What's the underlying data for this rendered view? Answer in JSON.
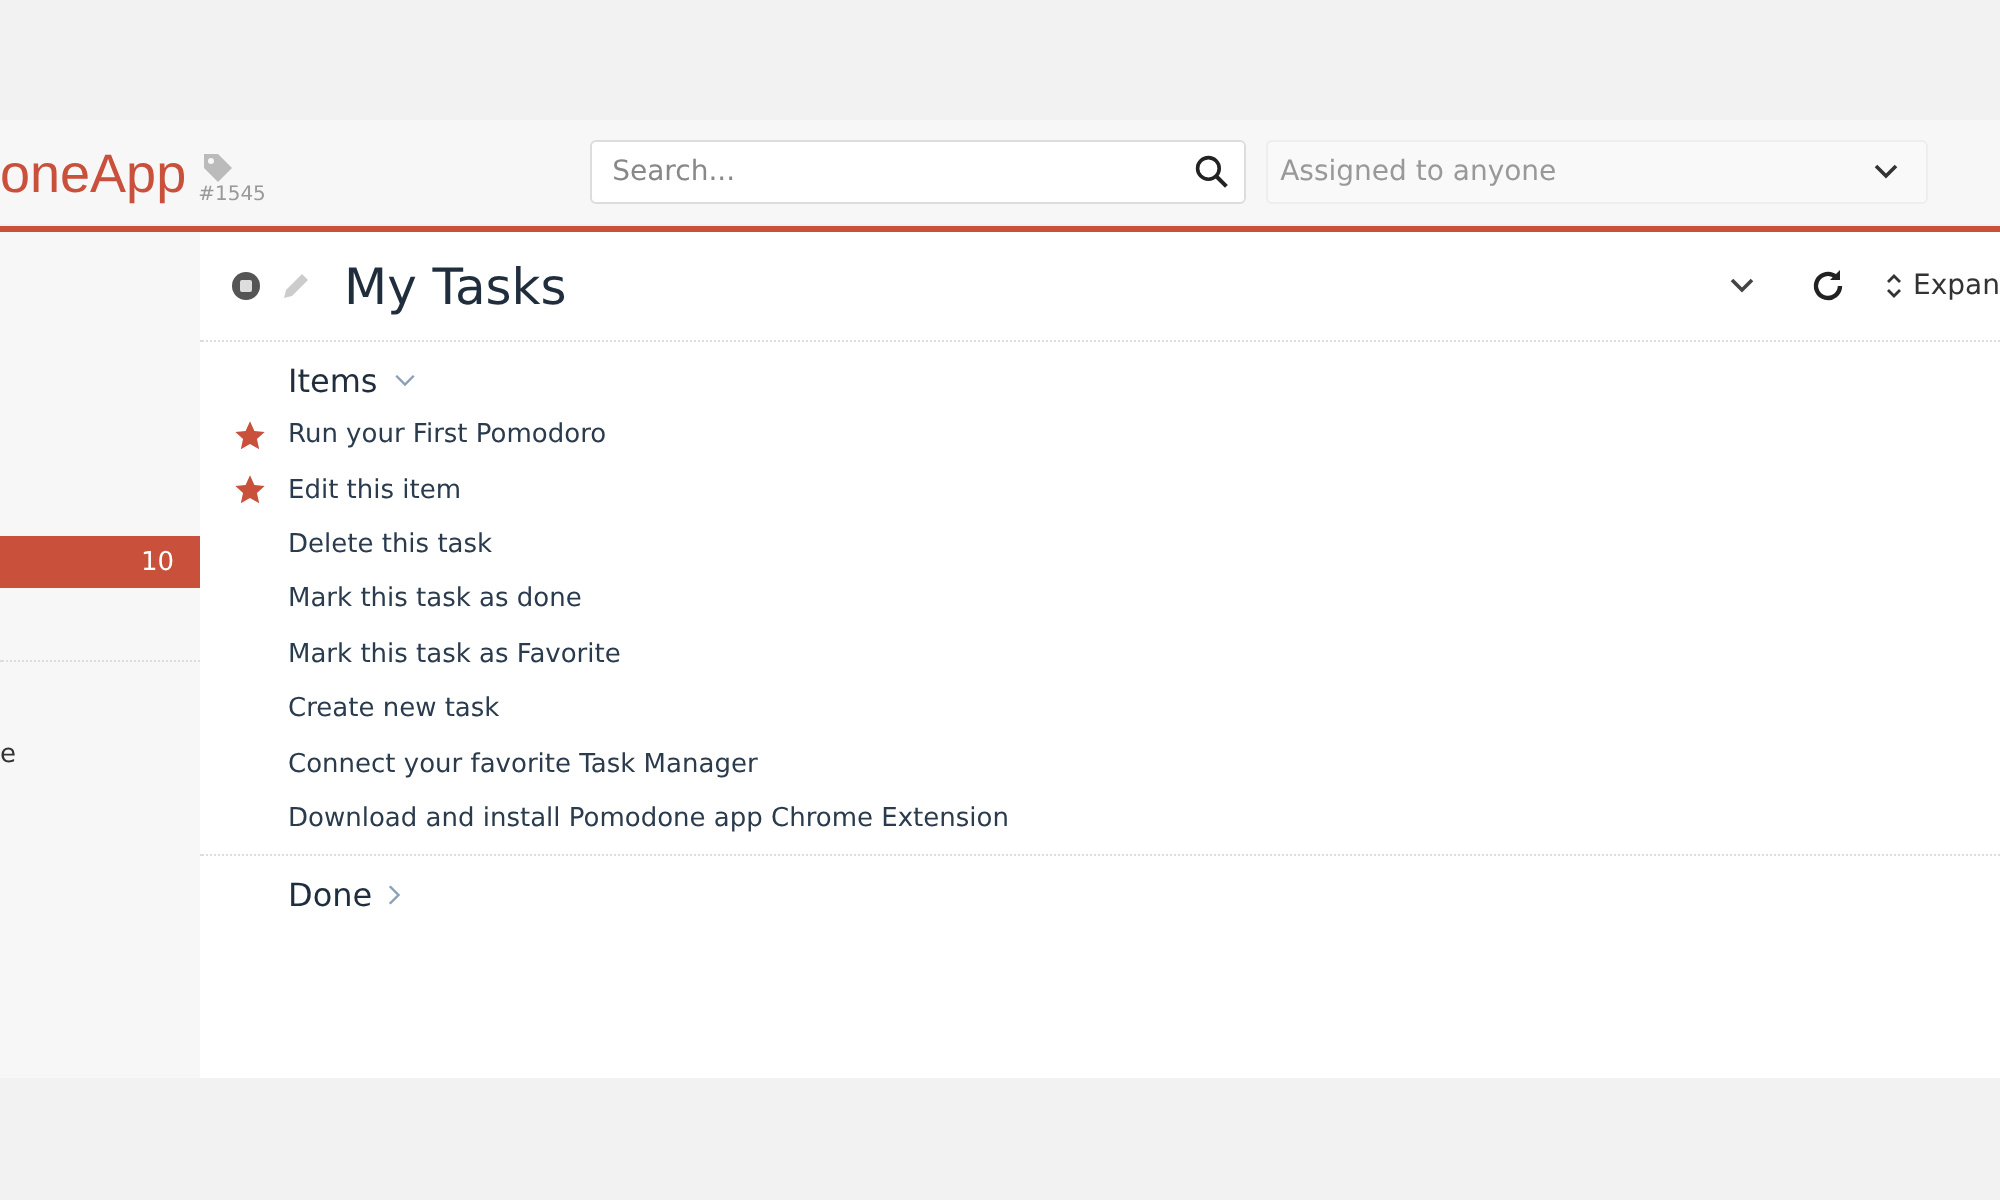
{
  "header": {
    "logo": "oneApp",
    "tag": "#1545",
    "search": {
      "placeholder": "Search..."
    },
    "assignee": {
      "placeholder": "Assigned to anyone"
    }
  },
  "sidebar": {
    "items": [
      {
        "count": "10",
        "selected": true
      },
      {
        "label": "e",
        "selected": false
      }
    ]
  },
  "toolbar": {
    "title": "My Tasks",
    "expand": "Expan"
  },
  "sections": [
    {
      "title": "Items",
      "expanded": true,
      "tasks": [
        {
          "label": "Run your First Pomodoro",
          "favorite": true
        },
        {
          "label": "Edit this item",
          "favorite": true
        },
        {
          "label": "Delete this task",
          "favorite": false
        },
        {
          "label": "Mark this task as done",
          "favorite": false
        },
        {
          "label": "Mark this task as Favorite",
          "favorite": false
        },
        {
          "label": "Create new task",
          "favorite": false
        },
        {
          "label": "Connect your favorite Task Manager",
          "favorite": false
        },
        {
          "label": "Download and install Pomodone app Chrome Extension",
          "favorite": false
        }
      ]
    },
    {
      "title": "Done",
      "expanded": false
    }
  ]
}
